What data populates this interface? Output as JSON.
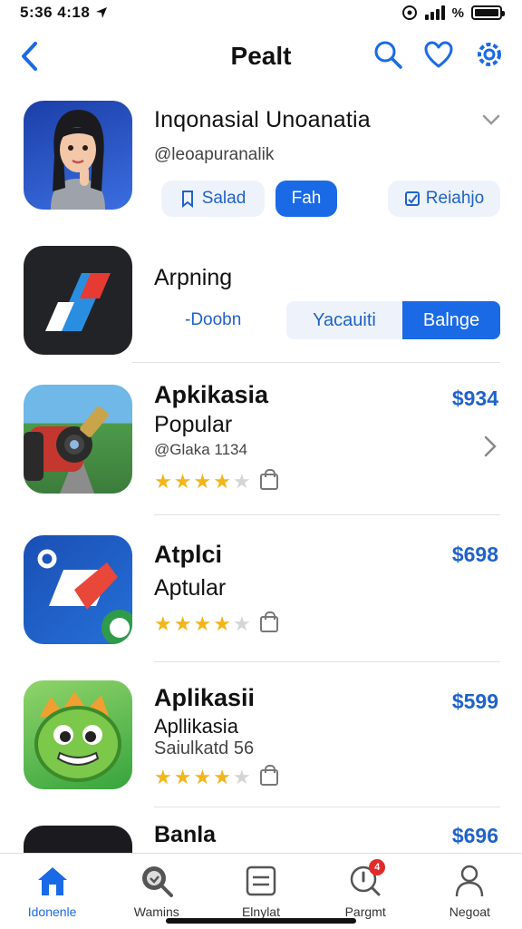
{
  "status": {
    "time": "5:36 4:18",
    "network": "%"
  },
  "nav": {
    "title": "Pealt"
  },
  "featured": {
    "title": "Inqonasial Unoanatia",
    "handle": "@leoapuranalik",
    "buttons": {
      "saved": "Salad",
      "follow": "Fah",
      "related": "Reiahjo"
    }
  },
  "section2": {
    "title": "Arpning",
    "left_label": "-Doobn",
    "seg_a": "Yacauiti",
    "seg_b": "Balnge"
  },
  "apps": [
    {
      "name": "Apkikasia",
      "category": "Popular",
      "meta": "@Glaka 1134",
      "price": "$934",
      "rating": 3.5
    },
    {
      "name": "Atplci",
      "category": "Aptular",
      "meta": "",
      "price": "$698",
      "rating": 3.5
    },
    {
      "name": "Aplikasii",
      "category": "Apllikasia",
      "meta": "Saiulkatd 56",
      "price": "$599",
      "rating": 3.5
    },
    {
      "name": "Banla",
      "category": "",
      "meta": "",
      "price": "$696",
      "rating": 0
    }
  ],
  "tabs": [
    {
      "label": "Idonenle",
      "icon": "home-icon",
      "active": true
    },
    {
      "label": "Wamins",
      "icon": "search-icon",
      "active": false
    },
    {
      "label": "Elnylat",
      "icon": "list-icon",
      "active": false
    },
    {
      "label": "Pargmt",
      "icon": "notification-icon",
      "active": false,
      "badge": "4"
    },
    {
      "label": "Negoat",
      "icon": "profile-icon",
      "active": false
    }
  ],
  "colors": {
    "accent": "#1a6ae6",
    "price": "#1f62c9",
    "star": "#f3b51a",
    "badge": "#e02b2b"
  }
}
